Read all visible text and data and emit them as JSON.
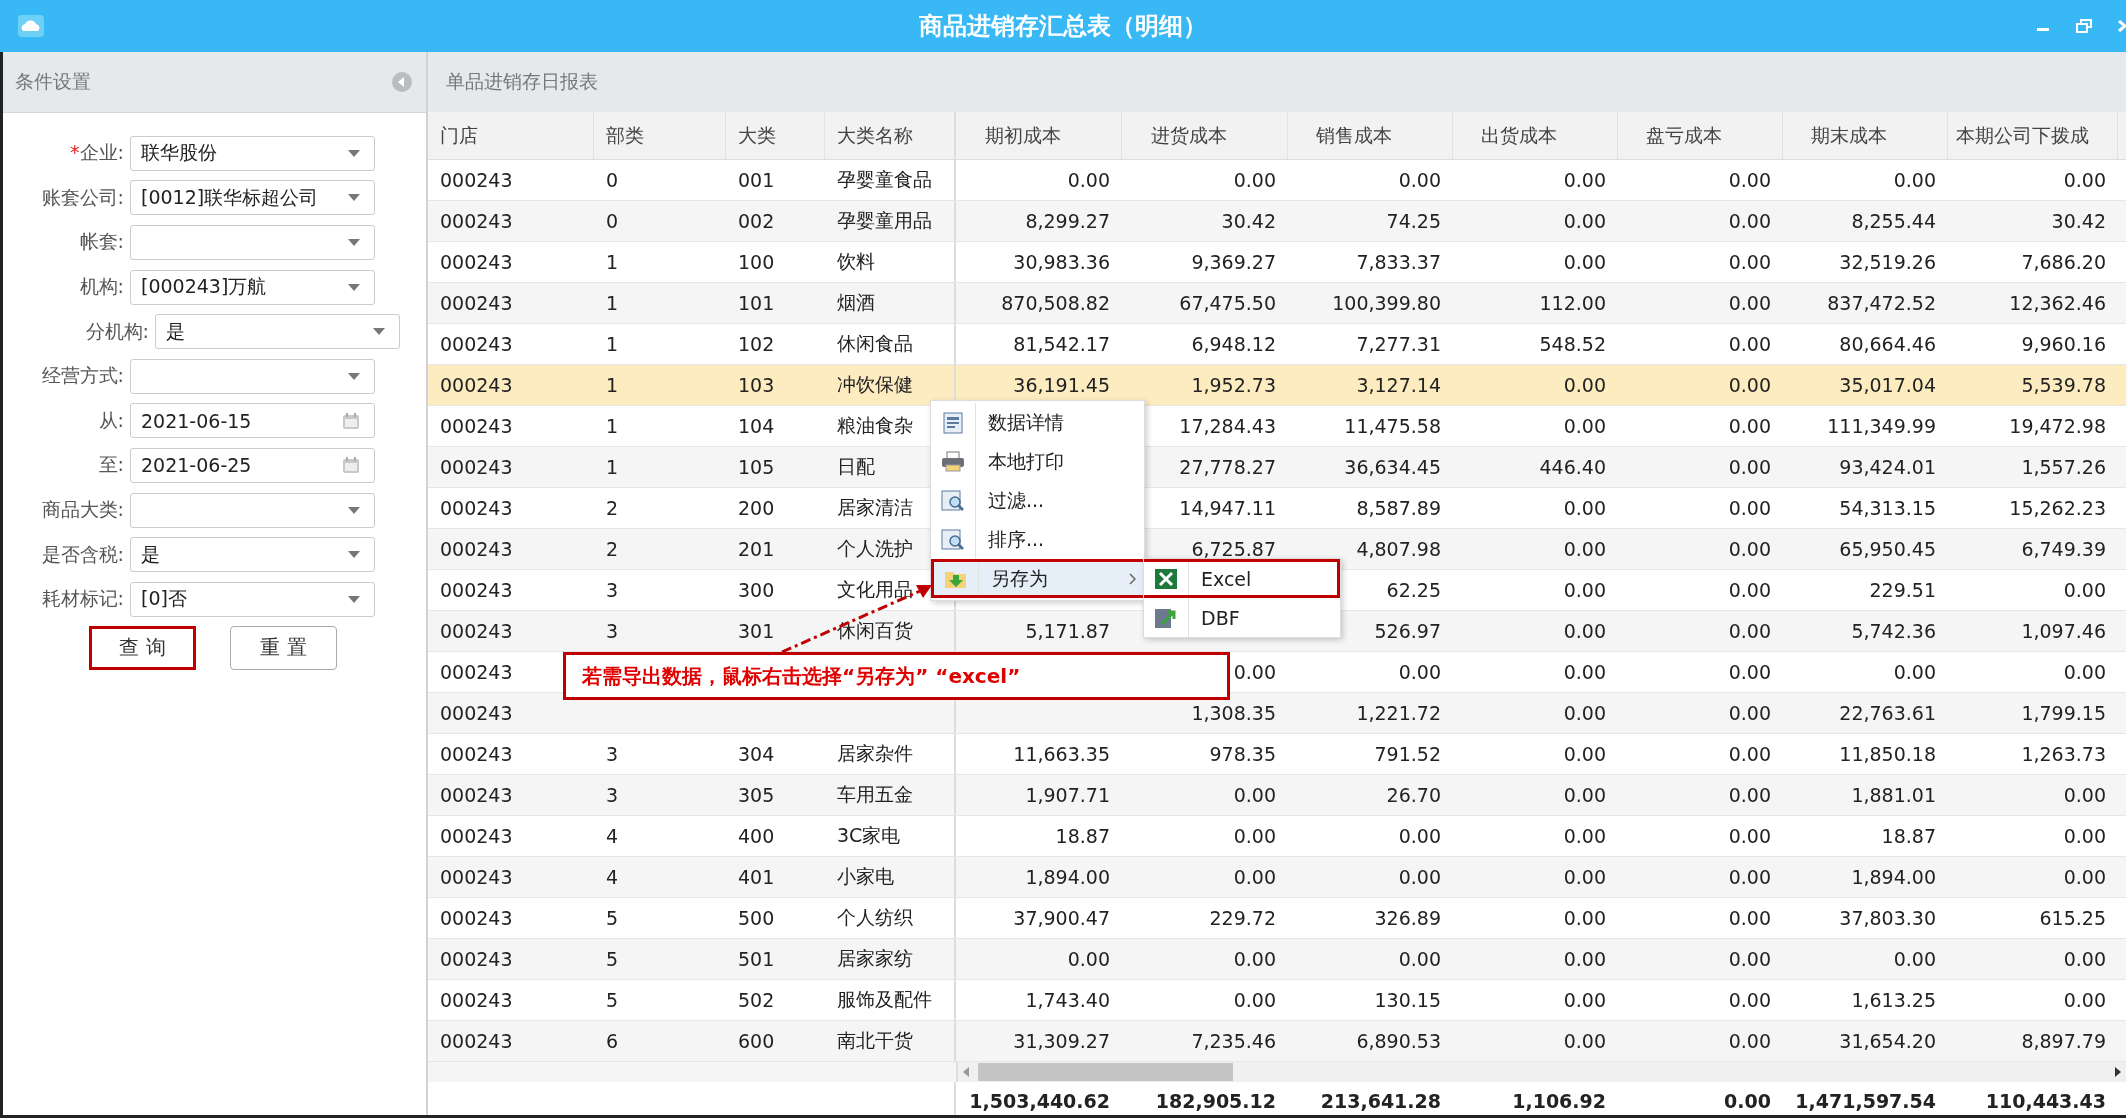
{
  "window": {
    "title": "商品进销存汇总表（明细）"
  },
  "filter_panel": {
    "title": "条件设置",
    "fields": [
      {
        "label": "企业:",
        "required_mark": "*",
        "value": "联华股份",
        "kind": "dropdown"
      },
      {
        "label": "账套公司:",
        "value": "[0012]联华标超公司",
        "kind": "dropdown"
      },
      {
        "label": "帐套:",
        "kind": "dropdown"
      },
      {
        "label": "机构:",
        "value": "[000243]万航",
        "kind": "dropdown"
      },
      {
        "label": "分机构:",
        "value": "是",
        "kind": "dropdown",
        "offset": true
      },
      {
        "label": "经营方式:",
        "kind": "dropdown"
      },
      {
        "label": "从:",
        "value": "2021-06-15",
        "kind": "date"
      },
      {
        "label": "至:",
        "value": "2021-06-25",
        "kind": "date"
      },
      {
        "label": "商品大类:",
        "kind": "dropdown"
      },
      {
        "label": "是否含税:",
        "value": "是",
        "kind": "dropdown"
      },
      {
        "label": "耗材标记:",
        "value": "[0]否",
        "kind": "dropdown"
      }
    ],
    "buttons": [
      {
        "label": "查 询",
        "highlighted": true
      },
      {
        "label": "重 置",
        "highlighted": false
      }
    ]
  },
  "report": {
    "title": "单品进销存日报表",
    "columns": [
      "门店",
      "部类",
      "大类",
      "大类名称",
      "期初成本",
      "进货成本",
      "销售成本",
      "出货成本",
      "盘亏成本",
      "期末成本",
      "本期公司下拨成"
    ],
    "rows": [
      {
        "selected": false,
        "cells": [
          "000243",
          "0",
          "001",
          "孕婴童食品",
          "0.00",
          "0.00",
          "0.00",
          "0.00",
          "0.00",
          "0.00",
          "0.00"
        ]
      },
      {
        "selected": false,
        "cells": [
          "000243",
          "0",
          "002",
          "孕婴童用品",
          "8,299.27",
          "30.42",
          "74.25",
          "0.00",
          "0.00",
          "8,255.44",
          "30.42"
        ]
      },
      {
        "selected": false,
        "cells": [
          "000243",
          "1",
          "100",
          "饮料",
          "30,983.36",
          "9,369.27",
          "7,833.37",
          "0.00",
          "0.00",
          "32,519.26",
          "7,686.20"
        ]
      },
      {
        "selected": false,
        "cells": [
          "000243",
          "1",
          "101",
          "烟酒",
          "870,508.82",
          "67,475.50",
          "100,399.80",
          "112.00",
          "0.00",
          "837,472.52",
          "12,362.46"
        ]
      },
      {
        "selected": false,
        "cells": [
          "000243",
          "1",
          "102",
          "休闲食品",
          "81,542.17",
          "6,948.12",
          "7,277.31",
          "548.52",
          "0.00",
          "80,664.46",
          "9,960.16"
        ]
      },
      {
        "selected": true,
        "cells": [
          "000243",
          "1",
          "103",
          "冲饮保健",
          "36,191.45",
          "1,952.73",
          "3,127.14",
          "0.00",
          "0.00",
          "35,017.04",
          "5,539.78"
        ]
      },
      {
        "selected": false,
        "cells": [
          "000243",
          "1",
          "104",
          "粮油食杂",
          null,
          "17,284.43",
          "11,475.58",
          "0.00",
          "0.00",
          "111,349.99",
          "19,472.98"
        ]
      },
      {
        "selected": false,
        "cells": [
          "000243",
          "1",
          "105",
          "日配",
          null,
          "27,778.27",
          "36,634.45",
          "446.40",
          "0.00",
          "93,424.01",
          "1,557.26"
        ]
      },
      {
        "selected": false,
        "cells": [
          "000243",
          "2",
          "200",
          "居家清洁",
          null,
          "14,947.11",
          "8,587.89",
          "0.00",
          "0.00",
          "54,313.15",
          "15,262.23"
        ]
      },
      {
        "selected": false,
        "cells": [
          "000243",
          "2",
          "201",
          "个人洗护",
          null,
          "6,725.87",
          "4,807.98",
          "0.00",
          "0.00",
          "65,950.45",
          "6,749.39"
        ]
      },
      {
        "selected": false,
        "cells": [
          "000243",
          "3",
          "300",
          "文化用品",
          null,
          null,
          "62.25",
          "0.00",
          "0.00",
          "229.51",
          "0.00"
        ]
      },
      {
        "selected": false,
        "cells": [
          "000243",
          "3",
          "301",
          "休闲百货",
          "5,171.87",
          null,
          "526.97",
          "0.00",
          "0.00",
          "5,742.36",
          "1,097.46"
        ]
      },
      {
        "selected": false,
        "cells": [
          "000243",
          null,
          null,
          null,
          null,
          "0.00",
          "0.00",
          "0.00",
          "0.00",
          "0.00",
          "0.00"
        ]
      },
      {
        "selected": false,
        "cells": [
          "000243",
          null,
          null,
          null,
          null,
          "1,308.35",
          "1,221.72",
          "0.00",
          "0.00",
          "22,763.61",
          "1,799.15"
        ]
      },
      {
        "selected": false,
        "cells": [
          "000243",
          "3",
          "304",
          "居家杂件",
          "11,663.35",
          "978.35",
          "791.52",
          "0.00",
          "0.00",
          "11,850.18",
          "1,263.73"
        ]
      },
      {
        "selected": false,
        "cells": [
          "000243",
          "3",
          "305",
          "车用五金",
          "1,907.71",
          "0.00",
          "26.70",
          "0.00",
          "0.00",
          "1,881.01",
          "0.00"
        ]
      },
      {
        "selected": false,
        "cells": [
          "000243",
          "4",
          "400",
          "3C家电",
          "18.87",
          "0.00",
          "0.00",
          "0.00",
          "0.00",
          "18.87",
          "0.00"
        ]
      },
      {
        "selected": false,
        "cells": [
          "000243",
          "4",
          "401",
          "小家电",
          "1,894.00",
          "0.00",
          "0.00",
          "0.00",
          "0.00",
          "1,894.00",
          "0.00"
        ]
      },
      {
        "selected": false,
        "cells": [
          "000243",
          "5",
          "500",
          "个人纺织",
          "37,900.47",
          "229.72",
          "326.89",
          "0.00",
          "0.00",
          "37,803.30",
          "615.25"
        ]
      },
      {
        "selected": false,
        "cells": [
          "000243",
          "5",
          "501",
          "居家家纺",
          "0.00",
          "0.00",
          "0.00",
          "0.00",
          "0.00",
          "0.00",
          "0.00"
        ]
      },
      {
        "selected": false,
        "cells": [
          "000243",
          "5",
          "502",
          "服饰及配件",
          "1,743.40",
          "0.00",
          "130.15",
          "0.00",
          "0.00",
          "1,613.25",
          "0.00"
        ]
      },
      {
        "selected": false,
        "cells": [
          "000243",
          "6",
          "600",
          "南北干货",
          "31,309.27",
          "7,235.46",
          "6,890.53",
          "0.00",
          "0.00",
          "31,654.20",
          "8,897.79"
        ]
      }
    ],
    "totals": [
      "1,503,440.62",
      "182,905.12",
      "213,641.28",
      "1,106.92",
      "0.00",
      "1,471,597.54",
      "110,443.43"
    ]
  },
  "context_menu": {
    "items": [
      {
        "label": "数据详情",
        "has_submenu": false,
        "selected": false,
        "annotated": false
      },
      {
        "label": "本地打印",
        "has_submenu": false,
        "selected": false,
        "annotated": false
      },
      {
        "label": "过滤...",
        "has_submenu": false,
        "selected": false,
        "annotated": false
      },
      {
        "label": "排序...",
        "has_submenu": false,
        "selected": false,
        "annotated": false
      },
      {
        "label": "另存为",
        "has_submenu": true,
        "selected": true,
        "annotated": true
      }
    ],
    "submenu": [
      {
        "label": "Excel",
        "annotated": true
      },
      {
        "label": "DBF",
        "annotated": false
      }
    ]
  },
  "callout": {
    "text": "若需导出数据，鼠标右击选择“另存为” “excel”"
  }
}
